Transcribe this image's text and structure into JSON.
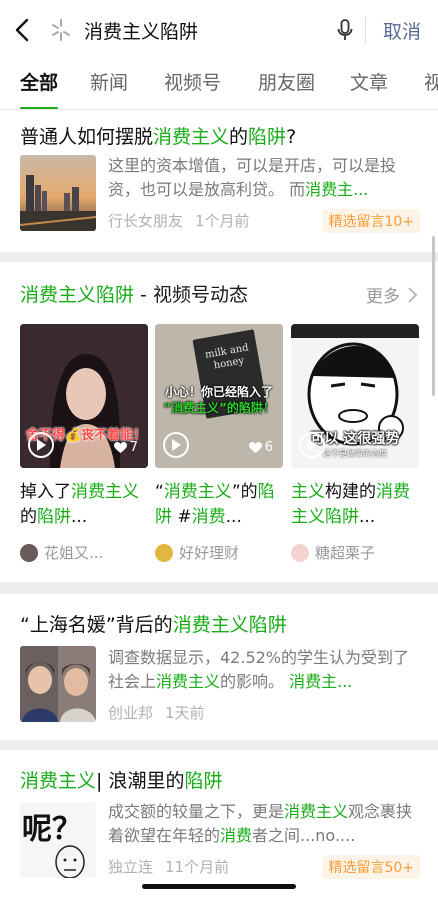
{
  "search": {
    "query": "消费主义陷阱",
    "cancel_label": "取消"
  },
  "tabs": [
    {
      "label": "全部",
      "active": true
    },
    {
      "label": "新闻"
    },
    {
      "label": "视频号"
    },
    {
      "label": "朋友圈"
    },
    {
      "label": "文章"
    },
    {
      "label": "视"
    }
  ],
  "results": [
    {
      "title_parts": [
        "普通人如何摆脱",
        "消费主义",
        "的",
        "陷阱",
        "?"
      ],
      "desc_parts": [
        "这里的资本增值，可以是开店，可以是投资，也可以是放高利贷。 而",
        "消费主..."
      ],
      "source": "行长女朋友",
      "time": "1个月前",
      "badge": "精选留言10+"
    },
    {
      "title_parts": [
        "“上海名媛”背后的",
        "消费主义陷阱",
        "",
        "",
        ""
      ],
      "desc_parts": [
        "调查数据显示，42.52%的学生认为受到了社会上",
        "消费主义",
        "的影响。 ",
        "消费主..."
      ],
      "source": "创业邦",
      "time": "1天前"
    },
    {
      "title_parts": [
        "消费主义",
        "| 浪潮里的",
        "陷阱"
      ],
      "desc_parts": [
        "成交额的较量之下，更是",
        "消费主义",
        "观念裹挟着欲望在年轻的",
        "消费",
        "者之间...no...."
      ],
      "source": "独立连",
      "time": "11个月前",
      "badge": "精选留言50+",
      "thumb_text": "呢？"
    }
  ],
  "video_section": {
    "title_highlight": "消费主义陷阱",
    "title_rest": " - 视频号动态",
    "more_label": "更多",
    "videos": [
      {
        "overlay_text": "舍不得💰丧不着能！",
        "likes": "7",
        "caption_parts": [
          "掉入了",
          "消费主",
          "义",
          "的",
          "陷阱",
          "..."
        ],
        "author": "花姐又..."
      },
      {
        "overlay_line1": "小心！你已经陷入了",
        "overlay_line2": "“消费主义”的陷阱！",
        "book_text": "milk and honey",
        "likes": "6",
        "caption_parts": [
          "“",
          "消费主义",
          "”的",
          "陷阱",
          " #",
          "消费",
          "..."
        ],
        "author": "好好理财"
      },
      {
        "overlay_text": "可以 这很强势",
        "overlay_sub": "这不是做事的态度",
        "caption_parts": [
          "主义",
          "构建的",
          "消",
          "费主义陷阱",
          "..."
        ],
        "author": "糖超栗子"
      }
    ]
  },
  "colors": {
    "highlight": "#1aad19",
    "link_blue": "#576b95",
    "badge_orange": "#fa9d3b"
  }
}
